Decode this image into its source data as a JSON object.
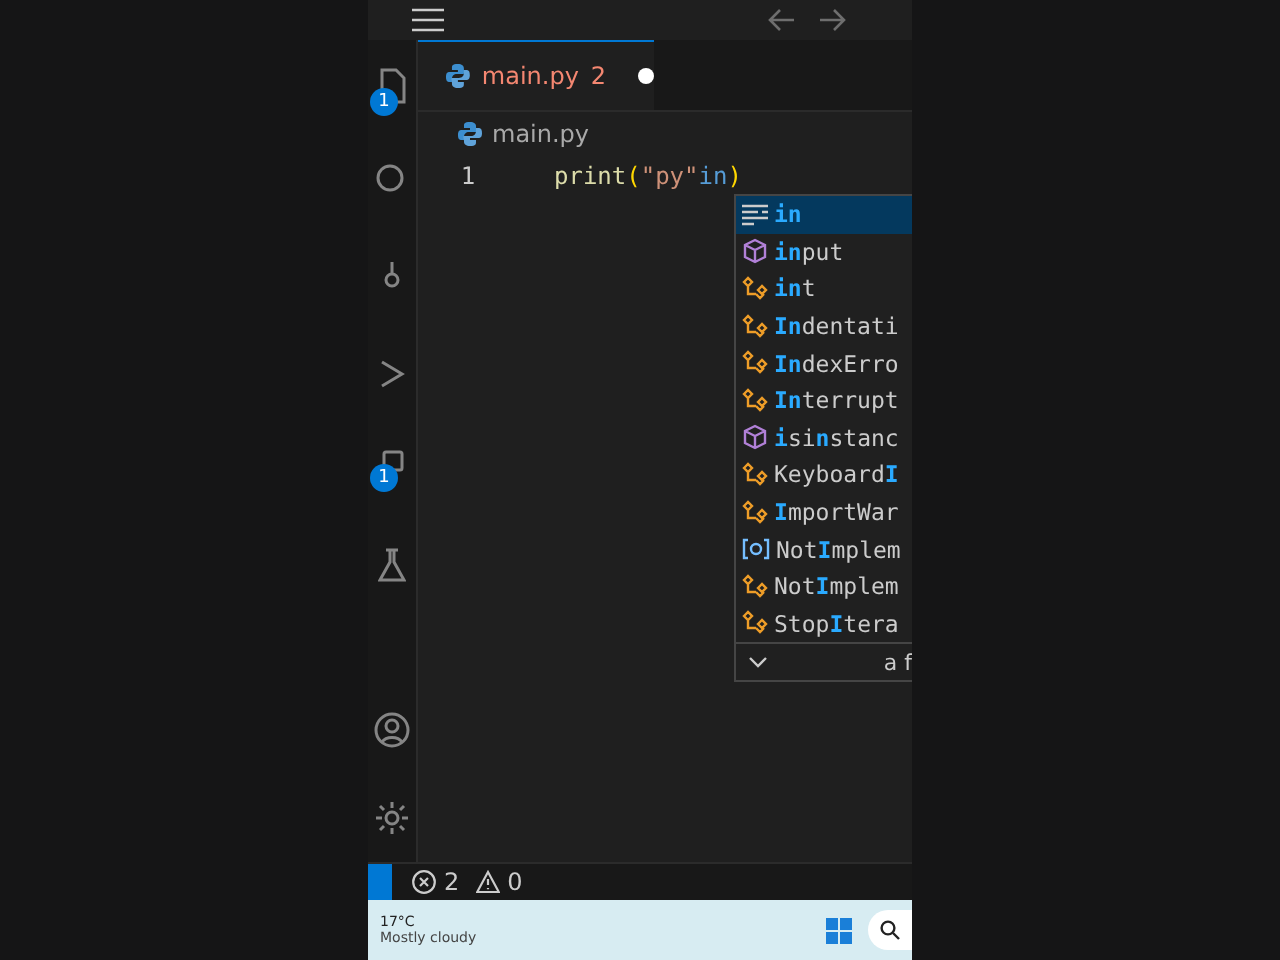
{
  "activity_bar": [
    {
      "kind": "files",
      "badge": "1"
    },
    {
      "kind": "search"
    },
    {
      "kind": "source-control"
    },
    {
      "kind": "run"
    },
    {
      "kind": "extensions",
      "badge": "1"
    },
    {
      "kind": "testing"
    },
    {
      "kind": "account"
    },
    {
      "kind": "settings"
    }
  ],
  "tab": {
    "label": "main.py",
    "problems": "2",
    "modified": true
  },
  "breadcrumb": "main.py",
  "editor": {
    "line_number": "1",
    "tokens": [
      {
        "kind": "function",
        "text": "print"
      },
      {
        "kind": "bracket",
        "text": "("
      },
      {
        "kind": "string",
        "text": "\"py\""
      },
      {
        "kind": "keyword",
        "text": "in"
      },
      {
        "kind": "bracket",
        "text": ")"
      }
    ]
  },
  "suggestions": [
    {
      "kind": "keyword",
      "selected": true,
      "parts": [
        {
          "text": "in",
          "match": true
        }
      ]
    },
    {
      "kind": "method",
      "selected": false,
      "parts": [
        {
          "text": "in",
          "match": true
        },
        {
          "text": "put",
          "match": false
        }
      ]
    },
    {
      "kind": "class",
      "selected": false,
      "parts": [
        {
          "text": "in",
          "match": true
        },
        {
          "text": "t",
          "match": false
        }
      ]
    },
    {
      "kind": "class",
      "selected": false,
      "parts": [
        {
          "text": "In",
          "match": true
        },
        {
          "text": "dentati",
          "match": false
        }
      ]
    },
    {
      "kind": "class",
      "selected": false,
      "parts": [
        {
          "text": "In",
          "match": true
        },
        {
          "text": "dexErro",
          "match": false
        }
      ]
    },
    {
      "kind": "class",
      "selected": false,
      "parts": [
        {
          "text": "In",
          "match": true
        },
        {
          "text": "terrupt",
          "match": false
        }
      ]
    },
    {
      "kind": "method",
      "selected": false,
      "parts": [
        {
          "text": "i",
          "match": true
        },
        {
          "text": "si",
          "match": false
        },
        {
          "text": "n",
          "match": true
        },
        {
          "text": "stanc",
          "match": false
        }
      ]
    },
    {
      "kind": "class",
      "selected": false,
      "parts": [
        {
          "text": "Keyboard",
          "match": false
        },
        {
          "text": "I",
          "match": true
        }
      ]
    },
    {
      "kind": "class",
      "selected": false,
      "parts": [
        {
          "text": "I",
          "match": true
        },
        {
          "text": "mportWar",
          "match": false
        }
      ]
    },
    {
      "kind": "variable",
      "selected": false,
      "parts": [
        {
          "text": "Not",
          "match": false
        },
        {
          "text": "I",
          "match": true
        },
        {
          "text": "mplem",
          "match": false
        }
      ]
    },
    {
      "kind": "class",
      "selected": false,
      "parts": [
        {
          "text": "Not",
          "match": false
        },
        {
          "text": "I",
          "match": true
        },
        {
          "text": "mplem",
          "match": false
        }
      ]
    },
    {
      "kind": "class",
      "selected": false,
      "parts": [
        {
          "text": "Stop",
          "match": false
        },
        {
          "text": "I",
          "match": true
        },
        {
          "text": "tera",
          "match": false
        }
      ]
    }
  ],
  "suggest_details": "a f",
  "status_bar": {
    "errors": "2",
    "warnings": "0"
  },
  "taskbar": {
    "temperature": "17°C",
    "weather": "Mostly cloudy"
  }
}
